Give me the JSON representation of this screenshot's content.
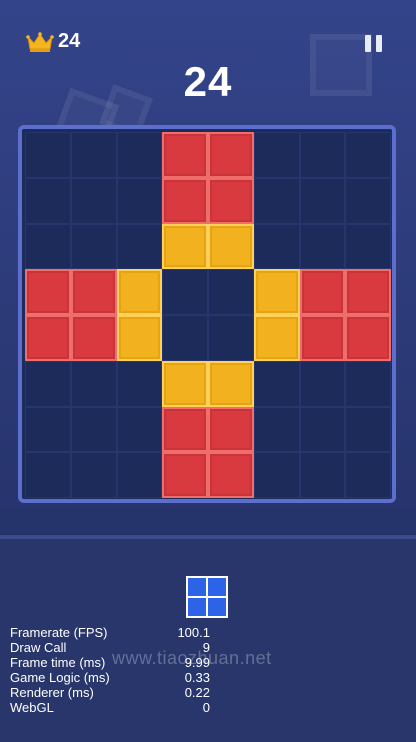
{
  "header": {
    "best_score": "24",
    "score": "24",
    "crown_icon": "crown-icon",
    "pause_icon": "pause-icon"
  },
  "board": {
    "rows": 8,
    "cols": 8,
    "cells": [
      [
        "",
        "",
        "",
        "red",
        "red",
        "",
        "",
        ""
      ],
      [
        "",
        "",
        "",
        "red",
        "red",
        "",
        "",
        ""
      ],
      [
        "",
        "",
        "",
        "yellow",
        "yellow",
        "",
        "",
        ""
      ],
      [
        "red",
        "red",
        "yellow",
        "",
        "",
        "yellow",
        "red",
        "red"
      ],
      [
        "red",
        "red",
        "yellow",
        "",
        "",
        "yellow",
        "red",
        "red"
      ],
      [
        "",
        "",
        "",
        "yellow",
        "yellow",
        "",
        "",
        ""
      ],
      [
        "",
        "",
        "",
        "red",
        "red",
        "",
        "",
        ""
      ],
      [
        "",
        "",
        "",
        "red",
        "red",
        "",
        "",
        ""
      ]
    ],
    "colors": {
      "red": "#d83a3f",
      "yellow": "#f2b21f",
      "empty": "#1d2b5b",
      "border": "#5d6fcc"
    }
  },
  "next_piece": {
    "shape": "2x2 square",
    "color": "#2d63e6"
  },
  "stats": [
    {
      "label": "Framerate (FPS)",
      "value": "100.1"
    },
    {
      "label": "Draw Call",
      "value": "9"
    },
    {
      "label": "Frame time (ms)",
      "value": "9.99"
    },
    {
      "label": "Game Logic (ms)",
      "value": "0.33"
    },
    {
      "label": "Renderer (ms)",
      "value": "0.22"
    },
    {
      "label": "WebGL",
      "value": "0"
    }
  ],
  "watermark": "www.tiaozhuan.net"
}
